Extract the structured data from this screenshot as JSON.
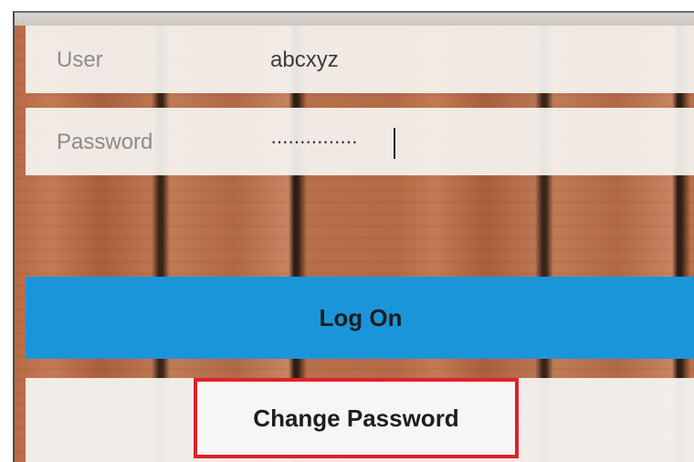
{
  "login": {
    "user_label": "User",
    "user_value": "abcxyz",
    "password_label": "Password",
    "password_masked": "···············",
    "logon_label": "Log On",
    "change_password_label": "Change Password"
  },
  "colors": {
    "logon_button": "#1b95da",
    "highlight_border": "#e0202a",
    "field_background": "#f5f3f0",
    "background_wood": "#b66a45"
  },
  "icons": {
    "text_caret": "caret-icon"
  }
}
